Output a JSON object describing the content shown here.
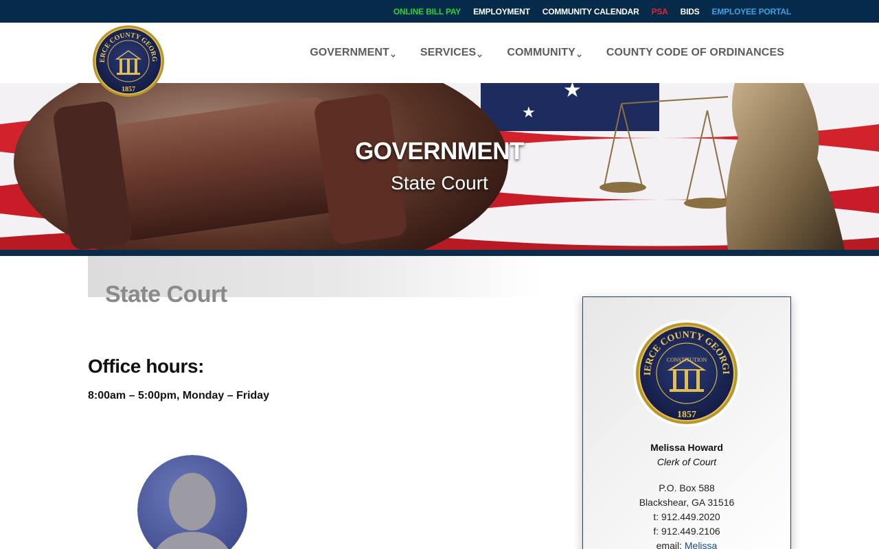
{
  "topbar": {
    "links": [
      {
        "label": "ONLINE BILL PAY",
        "color": "#27d43a"
      },
      {
        "label": "EMPLOYMENT",
        "color": "#ffffff"
      },
      {
        "label": "COMMUNITY CALENDAR",
        "color": "#ffffff"
      },
      {
        "label": "PSA",
        "color": "#e4232c"
      },
      {
        "label": "BIDS",
        "color": "#ffffff"
      },
      {
        "label": "EMPLOYEE PORTAL",
        "color": "#3fa2e6"
      }
    ]
  },
  "logo": {
    "top_text": "PIERCE COUNTY GEORGIA",
    "inner_text": "CONSTITUTION",
    "year": "1857"
  },
  "nav": {
    "items": [
      {
        "label": "GOVERNMENT",
        "has_dropdown": true
      },
      {
        "label": "SERVICES",
        "has_dropdown": true
      },
      {
        "label": "COMMUNITY",
        "has_dropdown": true
      },
      {
        "label": "COUNTY CODE OF ORDINANCES",
        "has_dropdown": false
      }
    ]
  },
  "hero": {
    "title": "GOVERNMENT",
    "subtitle": "State Court"
  },
  "main": {
    "page_title": "State Court",
    "hours_heading": "Office hours:",
    "hours_text": "8:00am – 5:00pm, Monday – Friday"
  },
  "contact_card": {
    "name": "Melissa Howard",
    "role": "Clerk of Court",
    "address_line1": "P.O. Box 588",
    "address_line2": "Blackshear, GA 31516",
    "phone": "t: 912.449.2020",
    "fax": "f: 912.449.2106",
    "email_prefix": "email: ",
    "email_link": "Melissa"
  },
  "colors": {
    "topbar_bg": "#062a4a",
    "nav_text": "#5c5c5c",
    "accent_strip": "#0b2b4b",
    "link": "#1a4a8a"
  }
}
